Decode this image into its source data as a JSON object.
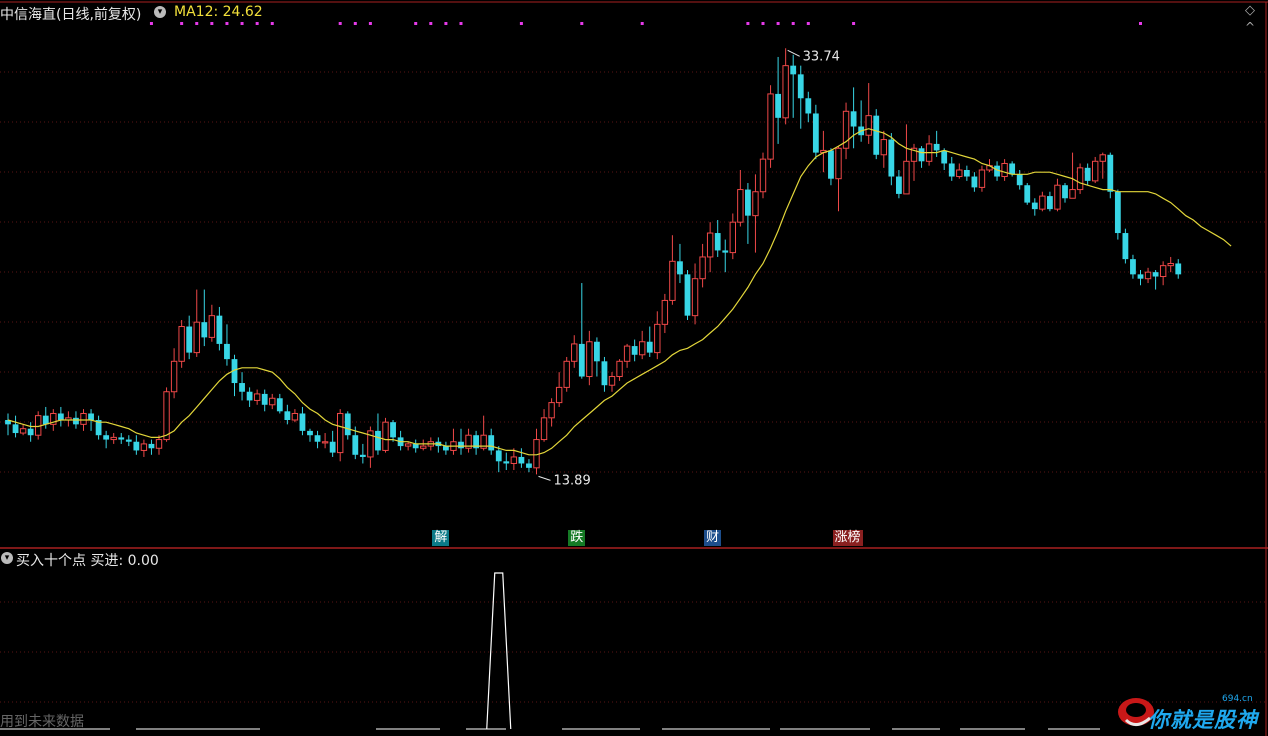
{
  "header": {
    "title": "中信海直(日线,前复权)",
    "toggle_icon": "chevron-down-icon",
    "ma_label": "MA12: 24.62",
    "corner_icon": "diamond-icon"
  },
  "colors": {
    "up": "#ee4848",
    "down": "#38d6e6",
    "ma": "#e2d63a",
    "grid": "#5a1414",
    "marker": "#e63aea",
    "indicator": "#ffffff"
  },
  "chart_data": {
    "type": "candlestick",
    "title": "中信海直(日线,前复权)",
    "ma_name": "MA12",
    "ma_last": 24.62,
    "price_high_label": "33.74",
    "price_low_label": "13.89",
    "ylim": [
      12.0,
      35.0
    ],
    "candles": [
      [
        16.6,
        16.4,
        16.9,
        15.9
      ],
      [
        16.4,
        16.0,
        16.8,
        15.8
      ],
      [
        16.0,
        16.2,
        16.4,
        15.9
      ],
      [
        16.2,
        15.9,
        16.5,
        15.6
      ],
      [
        15.9,
        16.8,
        17.0,
        15.7
      ],
      [
        16.8,
        16.4,
        17.2,
        16.2
      ],
      [
        16.4,
        16.9,
        17.1,
        16.1
      ],
      [
        16.9,
        16.6,
        17.2,
        16.3
      ],
      [
        16.6,
        16.7,
        17.0,
        16.3
      ],
      [
        16.7,
        16.4,
        17.0,
        16.2
      ],
      [
        16.4,
        16.9,
        17.1,
        16.1
      ],
      [
        16.9,
        16.6,
        17.1,
        16.1
      ],
      [
        16.6,
        15.9,
        16.8,
        15.7
      ],
      [
        15.9,
        15.7,
        16.1,
        15.3
      ],
      [
        15.7,
        15.8,
        16.0,
        15.5
      ],
      [
        15.8,
        15.7,
        16.0,
        15.5
      ],
      [
        15.7,
        15.6,
        15.9,
        15.4
      ],
      [
        15.6,
        15.2,
        15.9,
        15.0
      ],
      [
        15.2,
        15.5,
        15.7,
        14.9
      ],
      [
        15.5,
        15.3,
        15.7,
        15.0
      ],
      [
        15.3,
        15.7,
        15.9,
        15.0
      ],
      [
        15.7,
        17.9,
        18.1,
        15.6
      ],
      [
        17.9,
        19.3,
        19.9,
        17.6
      ],
      [
        19.3,
        20.9,
        21.2,
        19.0
      ],
      [
        20.9,
        19.7,
        21.4,
        19.4
      ],
      [
        19.7,
        21.1,
        22.6,
        19.5
      ],
      [
        21.1,
        20.4,
        22.6,
        20.0
      ],
      [
        20.4,
        21.4,
        21.9,
        20.2
      ],
      [
        21.4,
        20.1,
        21.8,
        19.8
      ],
      [
        20.1,
        19.4,
        21.0,
        19.1
      ],
      [
        19.4,
        18.3,
        19.6,
        17.7
      ],
      [
        18.3,
        17.9,
        18.8,
        17.5
      ],
      [
        17.9,
        17.5,
        18.1,
        17.2
      ],
      [
        17.5,
        17.8,
        18.0,
        17.3
      ],
      [
        17.8,
        17.3,
        18.0,
        17.0
      ],
      [
        17.3,
        17.6,
        17.8,
        17.1
      ],
      [
        17.6,
        17.0,
        17.8,
        16.9
      ],
      [
        17.0,
        16.6,
        17.3,
        16.4
      ],
      [
        16.6,
        16.9,
        17.1,
        16.5
      ],
      [
        16.9,
        16.1,
        17.2,
        15.9
      ],
      [
        16.1,
        15.9,
        16.2,
        15.6
      ],
      [
        15.9,
        15.6,
        16.1,
        15.3
      ],
      [
        15.6,
        15.6,
        16.0,
        15.3
      ],
      [
        15.6,
        15.1,
        16.1,
        14.9
      ],
      [
        15.1,
        16.9,
        17.1,
        14.7
      ],
      [
        16.9,
        15.9,
        17.0,
        15.7
      ],
      [
        15.9,
        15.0,
        16.3,
        14.8
      ],
      [
        15.0,
        14.9,
        15.5,
        14.6
      ],
      [
        14.9,
        16.1,
        16.3,
        14.4
      ],
      [
        16.1,
        15.2,
        16.9,
        15.0
      ],
      [
        15.2,
        16.5,
        16.7,
        15.1
      ],
      [
        16.5,
        15.8,
        16.6,
        15.6
      ],
      [
        15.8,
        15.4,
        16.1,
        15.2
      ],
      [
        15.4,
        15.5,
        15.6,
        15.2
      ],
      [
        15.5,
        15.3,
        15.7,
        15.1
      ],
      [
        15.3,
        15.4,
        15.7,
        15.2
      ],
      [
        15.4,
        15.6,
        15.8,
        15.2
      ],
      [
        15.6,
        15.4,
        15.8,
        15.1
      ],
      [
        15.4,
        15.2,
        15.6,
        15.0
      ],
      [
        15.2,
        15.6,
        16.2,
        15.0
      ],
      [
        15.6,
        15.3,
        16.2,
        15.0
      ],
      [
        15.3,
        15.9,
        16.2,
        15.1
      ],
      [
        15.9,
        15.3,
        16.1,
        15.0
      ],
      [
        15.3,
        15.9,
        16.8,
        15.2
      ],
      [
        15.9,
        15.2,
        16.2,
        15.0
      ],
      [
        15.2,
        14.7,
        15.4,
        14.2
      ],
      [
        14.7,
        14.6,
        15.1,
        14.3
      ],
      [
        14.6,
        14.9,
        15.3,
        14.3
      ],
      [
        14.9,
        14.6,
        15.3,
        14.4
      ],
      [
        14.6,
        14.4,
        14.8,
        14.2
      ],
      [
        14.4,
        15.7,
        16.2,
        14.1
      ],
      [
        15.7,
        16.7,
        17.1,
        15.6
      ],
      [
        16.7,
        17.4,
        17.6,
        16.3
      ],
      [
        17.4,
        18.1,
        18.8,
        17.2
      ],
      [
        18.1,
        19.3,
        19.5,
        17.9
      ],
      [
        19.3,
        20.1,
        20.5,
        19.0
      ],
      [
        20.1,
        18.6,
        22.9,
        18.5
      ],
      [
        18.6,
        20.2,
        20.7,
        18.2
      ],
      [
        20.2,
        19.3,
        20.4,
        18.6
      ],
      [
        19.3,
        18.2,
        19.5,
        17.9
      ],
      [
        18.2,
        18.6,
        18.8,
        17.9
      ],
      [
        18.6,
        19.3,
        19.4,
        18.4
      ],
      [
        19.3,
        20.0,
        20.1,
        19.0
      ],
      [
        20.0,
        19.6,
        20.3,
        19.3
      ],
      [
        19.6,
        20.2,
        20.7,
        19.4
      ],
      [
        20.2,
        19.7,
        20.9,
        19.5
      ],
      [
        19.7,
        21.0,
        21.6,
        19.4
      ],
      [
        21.0,
        22.1,
        22.4,
        20.6
      ],
      [
        22.1,
        23.9,
        25.1,
        21.9
      ],
      [
        23.9,
        23.3,
        24.7,
        22.9
      ],
      [
        23.3,
        21.4,
        23.5,
        21.2
      ],
      [
        21.4,
        23.1,
        23.8,
        21.0
      ],
      [
        23.1,
        24.1,
        24.7,
        22.7
      ],
      [
        24.1,
        25.2,
        25.7,
        23.4
      ],
      [
        25.2,
        24.4,
        25.8,
        24.1
      ],
      [
        24.4,
        24.3,
        24.9,
        23.4
      ],
      [
        24.3,
        25.7,
        26.1,
        24.0
      ],
      [
        25.7,
        27.2,
        28.1,
        25.5
      ],
      [
        27.2,
        26.0,
        27.5,
        24.7
      ],
      [
        26.0,
        27.1,
        27.9,
        24.3
      ],
      [
        27.1,
        28.6,
        28.9,
        26.8
      ],
      [
        28.6,
        31.6,
        32.0,
        28.2
      ],
      [
        31.6,
        30.5,
        33.3,
        29.3
      ],
      [
        30.5,
        32.9,
        33.7,
        30.2
      ],
      [
        32.9,
        32.5,
        33.4,
        30.5
      ],
      [
        32.5,
        31.4,
        32.9,
        30.0
      ],
      [
        31.4,
        30.7,
        31.7,
        30.3
      ],
      [
        30.7,
        28.9,
        31.1,
        28.6
      ],
      [
        28.9,
        29.0,
        29.9,
        28.0
      ],
      [
        29.0,
        27.7,
        29.1,
        27.4
      ],
      [
        27.7,
        29.1,
        29.2,
        26.2
      ],
      [
        29.1,
        30.8,
        31.2,
        28.6
      ],
      [
        30.8,
        30.1,
        31.9,
        29.1
      ],
      [
        30.1,
        29.7,
        31.3,
        29.4
      ],
      [
        29.7,
        30.6,
        32.1,
        29.3
      ],
      [
        30.6,
        28.8,
        30.9,
        28.6
      ],
      [
        28.8,
        29.5,
        29.9,
        28.2
      ],
      [
        29.5,
        27.8,
        29.8,
        27.4
      ],
      [
        27.8,
        27.0,
        28.1,
        26.8
      ],
      [
        27.0,
        28.5,
        30.2,
        27.0
      ],
      [
        28.5,
        29.1,
        29.3,
        27.6
      ],
      [
        29.1,
        28.5,
        29.2,
        28.2
      ],
      [
        28.5,
        29.3,
        29.7,
        28.3
      ],
      [
        29.3,
        29.0,
        29.9,
        28.7
      ],
      [
        29.0,
        28.4,
        29.1,
        28.1
      ],
      [
        28.4,
        27.8,
        28.7,
        27.6
      ],
      [
        27.8,
        28.1,
        28.4,
        27.7
      ],
      [
        28.1,
        27.8,
        28.3,
        27.6
      ],
      [
        27.8,
        27.3,
        28.0,
        27.1
      ],
      [
        27.3,
        28.1,
        28.3,
        27.1
      ],
      [
        28.1,
        28.3,
        28.6,
        28.0
      ],
      [
        28.3,
        27.8,
        28.5,
        27.6
      ],
      [
        27.8,
        28.4,
        28.6,
        27.6
      ],
      [
        28.4,
        27.9,
        28.5,
        27.8
      ],
      [
        27.9,
        27.4,
        28.1,
        27.2
      ],
      [
        27.4,
        26.6,
        27.5,
        26.5
      ],
      [
        26.6,
        26.3,
        26.8,
        26.0
      ],
      [
        26.3,
        26.9,
        27.1,
        26.2
      ],
      [
        26.9,
        26.3,
        27.1,
        26.2
      ],
      [
        26.3,
        27.4,
        27.7,
        26.2
      ],
      [
        27.4,
        26.8,
        27.5,
        26.6
      ],
      [
        26.8,
        27.2,
        28.9,
        26.9
      ],
      [
        27.2,
        28.2,
        28.4,
        27.0
      ],
      [
        28.2,
        27.6,
        28.4,
        27.4
      ],
      [
        27.6,
        28.5,
        28.7,
        27.5
      ],
      [
        28.5,
        28.8,
        28.9,
        27.7
      ],
      [
        28.8,
        27.1,
        28.9,
        26.8
      ],
      [
        27.1,
        25.2,
        27.2,
        24.9
      ],
      [
        25.2,
        24.0,
        25.4,
        23.8
      ],
      [
        24.0,
        23.3,
        24.2,
        23.1
      ],
      [
        23.3,
        23.1,
        23.5,
        22.8
      ],
      [
        23.1,
        23.4,
        23.6,
        22.9
      ],
      [
        23.4,
        23.2,
        23.5,
        22.6
      ],
      [
        23.2,
        23.7,
        23.9,
        22.8
      ],
      [
        23.7,
        23.8,
        24.1,
        23.4
      ],
      [
        23.8,
        23.3,
        24.0,
        23.1
      ]
    ],
    "ma_series": [
      16.6,
      16.5,
      16.4,
      16.3,
      16.3,
      16.4,
      16.5,
      16.6,
      16.6,
      16.6,
      16.6,
      16.6,
      16.5,
      16.5,
      16.4,
      16.3,
      16.2,
      16.0,
      15.9,
      15.8,
      15.8,
      15.9,
      16.1,
      16.5,
      16.8,
      17.2,
      17.6,
      18.0,
      18.4,
      18.7,
      18.9,
      19.0,
      19.0,
      19.0,
      18.9,
      18.8,
      18.5,
      18.1,
      17.8,
      17.4,
      17.1,
      16.9,
      16.6,
      16.4,
      16.3,
      16.2,
      16.1,
      16.0,
      15.9,
      15.8,
      15.7,
      15.7,
      15.6,
      15.6,
      15.5,
      15.5,
      15.5,
      15.5,
      15.4,
      15.4,
      15.4,
      15.4,
      15.4,
      15.4,
      15.4,
      15.3,
      15.2,
      15.2,
      15.1,
      15.0,
      15.0,
      15.1,
      15.3,
      15.6,
      15.9,
      16.3,
      16.6,
      16.9,
      17.2,
      17.5,
      17.7,
      18.0,
      18.3,
      18.5,
      18.7,
      18.9,
      19.1,
      19.3,
      19.6,
      19.8,
      19.9,
      20.1,
      20.3,
      20.6,
      20.9,
      21.3,
      21.7,
      22.2,
      22.7,
      23.3,
      23.8,
      24.5,
      25.3,
      26.2,
      27.0,
      27.8,
      28.3,
      28.7,
      28.9,
      29.0,
      29.2,
      29.4,
      29.7,
      29.9,
      30.0,
      29.9,
      29.8,
      29.6,
      29.3,
      29.1,
      29.0,
      28.9,
      28.9,
      28.9,
      29.0,
      28.9,
      28.8,
      28.7,
      28.6,
      28.4,
      28.3,
      28.1,
      28.0,
      27.9,
      27.9,
      27.9,
      28.0,
      28.0,
      28.0,
      27.9,
      27.8,
      27.7,
      27.5,
      27.4,
      27.3,
      27.2,
      27.2,
      27.1,
      27.1,
      27.1,
      27.1,
      27.1,
      27.0,
      26.8,
      26.6,
      26.3,
      26.0,
      25.8,
      25.5,
      25.3,
      25.1,
      24.9,
      24.6
    ],
    "events": [
      {
        "label": "解",
        "index": 57,
        "color": "#0b7a88"
      },
      {
        "label": "跌",
        "index": 75,
        "color": "#157a25"
      },
      {
        "label": "财",
        "index": 93,
        "color": "#1d4e8c"
      },
      {
        "label": "涨榜",
        "index": 110,
        "color": "#8a2020"
      }
    ],
    "marker_groups": [
      [
        19,
        23,
        25,
        27,
        29,
        31,
        33,
        35
      ],
      [
        44,
        46,
        48,
        54,
        56,
        58,
        60,
        68,
        76,
        84
      ],
      [
        98,
        100,
        102,
        104,
        106,
        112,
        150
      ]
    ]
  },
  "sub_panel": {
    "toggle_icon": "chevron-down-icon",
    "title": "买入十个点 买进: 0.00",
    "future_note": "用到未来数据",
    "indicator_peak_index": 65
  },
  "watermark": {
    "text": "你就是股神",
    "url": "694.cn",
    "logo_icon": "cobra-logo-icon"
  }
}
